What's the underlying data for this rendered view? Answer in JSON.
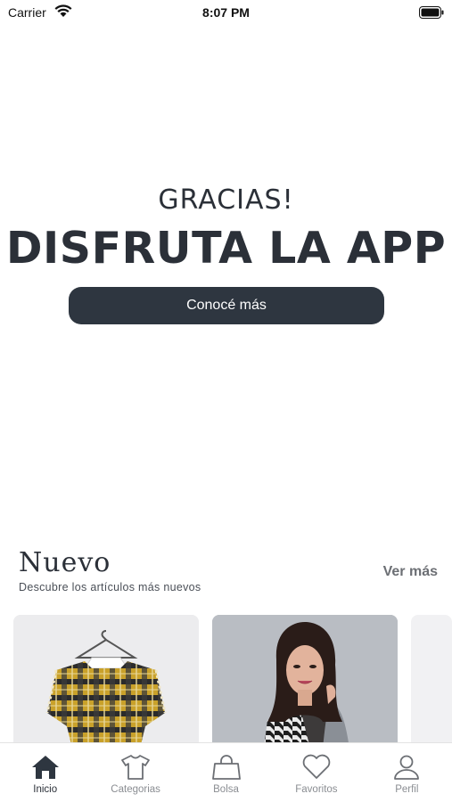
{
  "status_bar": {
    "carrier": "Carrier",
    "time": "8:07 PM",
    "icons": [
      "wifi-icon",
      "battery-icon"
    ]
  },
  "hero": {
    "subtitle": "GRACIAS!",
    "title": "DISFRUTA LA APP",
    "button_label": "Conocé más"
  },
  "nuevo": {
    "title": "Nuevo",
    "subtitle": "Descubre los artículos más nuevos",
    "see_more_label": "Ver más",
    "cards": [
      {
        "image": "plaid-ruffle-dress-on-hanger"
      },
      {
        "image": "woman-in-houndstooth-sweater"
      },
      {
        "image": "partial-product-card"
      }
    ]
  },
  "tab_bar": {
    "active": "Inicio",
    "tabs": [
      {
        "label": "Inicio",
        "icon": "home-icon"
      },
      {
        "label": "Categorias",
        "icon": "tshirt-icon"
      },
      {
        "label": "Bolsa",
        "icon": "bag-icon"
      },
      {
        "label": "Favoritos",
        "icon": "heart-icon"
      },
      {
        "label": "Perfil",
        "icon": "person-icon"
      }
    ]
  },
  "colors": {
    "primary": "#2e3640",
    "text": "#2b3038",
    "muted": "#8a8d92",
    "background": "#ffffff"
  }
}
